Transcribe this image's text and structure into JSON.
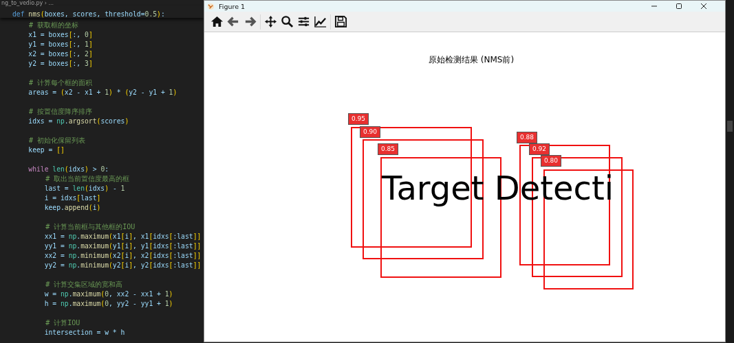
{
  "editor": {
    "breadcrumb": "ng_to_vedio.py › ...",
    "sticky_line": "def nms(boxes, scores, threshold=0.5):",
    "lines": [
      {
        "kind": "comment",
        "text": "    # 获取框的坐标"
      },
      {
        "kind": "code",
        "text": "    x1 = boxes[:, 0]"
      },
      {
        "kind": "code",
        "text": "    y1 = boxes[:, 1]"
      },
      {
        "kind": "code",
        "text": "    x2 = boxes[:, 2]"
      },
      {
        "kind": "code",
        "text": "    y2 = boxes[:, 3]"
      },
      {
        "kind": "blank"
      },
      {
        "kind": "comment",
        "text": "    # 计算每个框的面积"
      },
      {
        "kind": "code",
        "text": "    areas = (x2 - x1 + 1) * (y2 - y1 + 1)"
      },
      {
        "kind": "blank"
      },
      {
        "kind": "comment",
        "text": "    # 按置信度降序排序"
      },
      {
        "kind": "code",
        "text": "    idxs = np.argsort(scores)"
      },
      {
        "kind": "blank"
      },
      {
        "kind": "comment",
        "text": "    # 初始化保留列表"
      },
      {
        "kind": "code",
        "text": "    keep = []"
      },
      {
        "kind": "blank"
      },
      {
        "kind": "code",
        "text": "    while len(idxs) > 0:"
      },
      {
        "kind": "comment",
        "text": "        # 取出当前置信度最高的框"
      },
      {
        "kind": "code",
        "text": "        last = len(idxs) - 1"
      },
      {
        "kind": "code",
        "text": "        i = idxs[last]"
      },
      {
        "kind": "code",
        "text": "        keep.append(i)"
      },
      {
        "kind": "blank"
      },
      {
        "kind": "comment",
        "text": "        # 计算当前框与其他框的IOU"
      },
      {
        "kind": "code",
        "text": "        xx1 = np.maximum(x1[i], x1[idxs[:last]]"
      },
      {
        "kind": "code",
        "text": "        yy1 = np.maximum(y1[i], y1[idxs[:last]]"
      },
      {
        "kind": "code",
        "text": "        xx2 = np.minimum(x2[i], x2[idxs[:last]]"
      },
      {
        "kind": "code",
        "text": "        yy2 = np.minimum(y2[i], y2[idxs[:last]]"
      },
      {
        "kind": "blank"
      },
      {
        "kind": "comment",
        "text": "        # 计算交集区域的宽和高"
      },
      {
        "kind": "code",
        "text": "        w = np.maximum(0, xx2 - xx1 + 1)"
      },
      {
        "kind": "code",
        "text": "        h = np.maximum(0, yy2 - yy1 + 1)"
      },
      {
        "kind": "blank"
      },
      {
        "kind": "comment",
        "text": "        # 计算IOU"
      },
      {
        "kind": "code",
        "text": "        intersection = w * h"
      }
    ]
  },
  "figure_window": {
    "title": "Figure 1",
    "plot": {
      "title": "原始检测结果 (NMS前)",
      "image_text": "Target Detecti",
      "detections": [
        {
          "score": "0.95"
        },
        {
          "score": "0.90"
        },
        {
          "score": "0.85"
        },
        {
          "score": "0.88"
        },
        {
          "score": "0.92"
        },
        {
          "score": "0.80"
        }
      ]
    }
  }
}
